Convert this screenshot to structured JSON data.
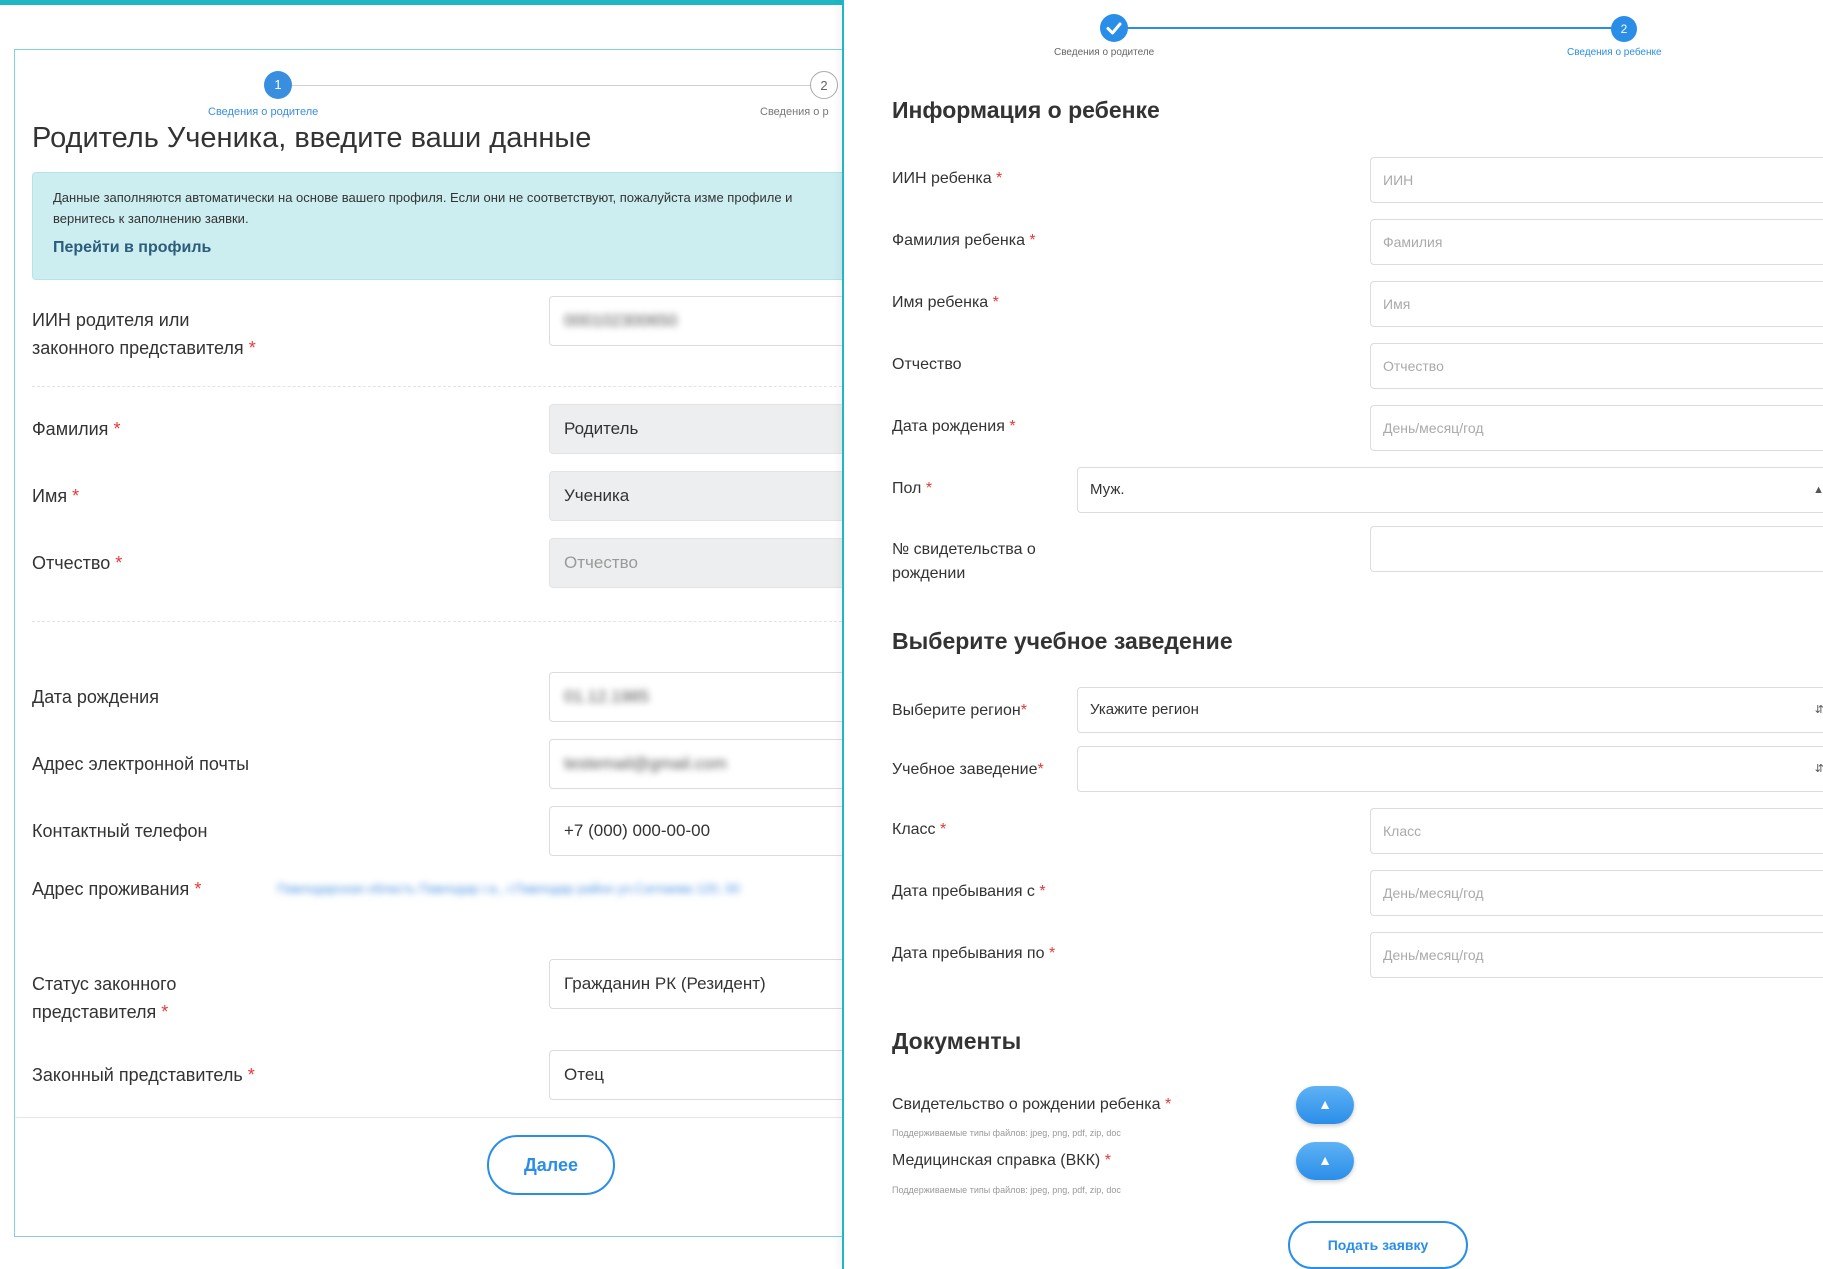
{
  "colors": {
    "accent": "#1fb7c4",
    "primary": "#2a8ee8",
    "required": "#e53935",
    "info_bg": "#cdeef1"
  },
  "left": {
    "stepper": {
      "step1": {
        "number": "1",
        "label": "Сведения о родителе"
      },
      "step2": {
        "number": "2",
        "label": "Сведения о р"
      }
    },
    "title": "Родитель Ученика, введите ваши данные",
    "info": {
      "text": "Данные заполняются автоматически на основе вашего профиля. Если они не соответствуют, пожалуйста изме профиле и вернитесь к заполнению заявки.",
      "link": "Перейти в профиль"
    },
    "fields": {
      "iin": {
        "label": "ИИН родителя или законного представителя",
        "value": "000102300650"
      },
      "surname": {
        "label": "Фамилия",
        "value": "Родитель"
      },
      "name": {
        "label": "Имя",
        "value": "Ученика"
      },
      "patronymic": {
        "label": "Отчество",
        "placeholder": "Отчество"
      },
      "birth": {
        "label": "Дата рождения",
        "value": "01.12.1985"
      },
      "email": {
        "label": "Адрес электронной почты",
        "value": "testemail@gmail.com"
      },
      "phone": {
        "label": "Контактный телефон",
        "value": "+7 (000) 000-00-00"
      },
      "address": {
        "label": "Адрес проживания",
        "value": "Павлодарская область Павлодар г.а., г.Павлодар район ул.Сатпаева 120, 00"
      },
      "status": {
        "label": "Статус законного представителя",
        "value": "Гражданин РК (Резидент)"
      },
      "rep": {
        "label": "Законный представитель",
        "value": "Отец"
      }
    },
    "next_button": "Далее"
  },
  "right": {
    "stepper": {
      "step1": {
        "label": "Сведения о родителе",
        "icon": "check-icon"
      },
      "step2": {
        "number": "2",
        "label": "Сведения о ребенке"
      }
    },
    "child_section": "Информация о ребенке",
    "child": {
      "iin": {
        "label": "ИИН ребенка",
        "placeholder": "ИИН"
      },
      "surname": {
        "label": "Фамилия ребенка",
        "placeholder": "Фамилия"
      },
      "name": {
        "label": "Имя ребенка",
        "placeholder": "Имя"
      },
      "patronymic": {
        "label": "Отчество",
        "placeholder": "Отчество"
      },
      "birth": {
        "label": "Дата рождения",
        "placeholder": "День/месяц/год"
      },
      "gender": {
        "label": "Пол",
        "value": "Муж."
      },
      "certificate": {
        "label": "№ свидетельства о рождении",
        "value": ""
      }
    },
    "school_section": "Выберите учебное заведение",
    "school": {
      "region": {
        "label": "Выберите регион",
        "value": "Укажите регион"
      },
      "institution": {
        "label": "Учебное заведение",
        "value": ""
      },
      "grade": {
        "label": "Класс",
        "placeholder": "Класс"
      },
      "from": {
        "label": "Дата пребывания с",
        "placeholder": "День/месяц/год"
      },
      "to": {
        "label": "Дата пребывания по",
        "placeholder": "День/месяц/год"
      }
    },
    "docs_section": "Документы",
    "docs": {
      "birth_cert": {
        "label": "Свидетельство о рождении ребенка",
        "hint": "Поддерживаемые типы файлов: jpeg, png, pdf, zip, doc"
      },
      "medical": {
        "label": "Медицинская справка (ВКК)",
        "hint": "Поддерживаемые типы файлов: jpeg, png, pdf, zip, doc"
      }
    },
    "submit_button": "Подать заявку"
  }
}
